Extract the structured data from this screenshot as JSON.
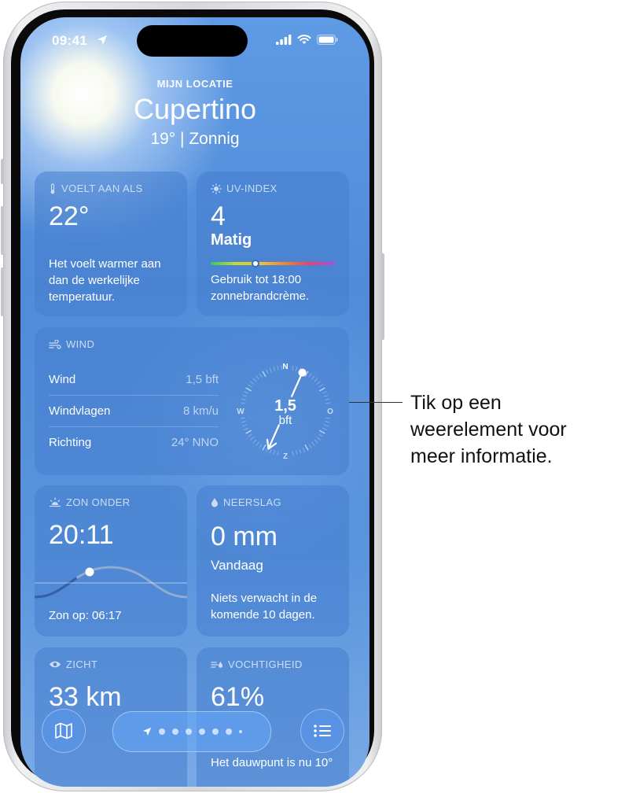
{
  "status": {
    "time": "09:41"
  },
  "header": {
    "sublabel": "MIJN LOCATIE",
    "city": "Cupertino",
    "condition": "19° | Zonnig"
  },
  "feels_like": {
    "title": "VOELT AAN ALS",
    "value": "22°",
    "description": "Het voelt warmer aan dan de werkelijke temperatuur."
  },
  "uv": {
    "title": "UV-INDEX",
    "value": "4",
    "level": "Matig",
    "level_fraction": 0.36,
    "description": "Gebruik tot 18:00 zonnebrandcrème."
  },
  "wind": {
    "title": "WIND",
    "rows": [
      {
        "label": "Wind",
        "value": "1,5 bft"
      },
      {
        "label": "Windvlagen",
        "value": "8 km/u"
      },
      {
        "label": "Richting",
        "value": "24° NNO"
      }
    ],
    "compass": {
      "n": "N",
      "o": "O",
      "z": "Z",
      "w": "W",
      "speed": "1,5",
      "unit": "bft",
      "direction_deg": 24
    }
  },
  "sunset": {
    "title": "ZON ONDER",
    "value": "20:11",
    "sunrise": "Zon op: 06:17"
  },
  "precip": {
    "title": "NEERSLAG",
    "value": "0 mm",
    "period": "Vandaag",
    "description": "Niets verwacht in de komende 10 dagen."
  },
  "visibility": {
    "title": "ZICHT",
    "value": "33 km"
  },
  "humidity": {
    "title": "VOCHTIGHEID",
    "value": "61%",
    "description": "Het dauwpunt is nu 10°"
  },
  "callout": {
    "line1": "Tik op een",
    "line2": "weerelement voor",
    "line3": "meer informatie."
  },
  "colors": {
    "sky": "#4f8bd8",
    "card": "#467dcd"
  }
}
